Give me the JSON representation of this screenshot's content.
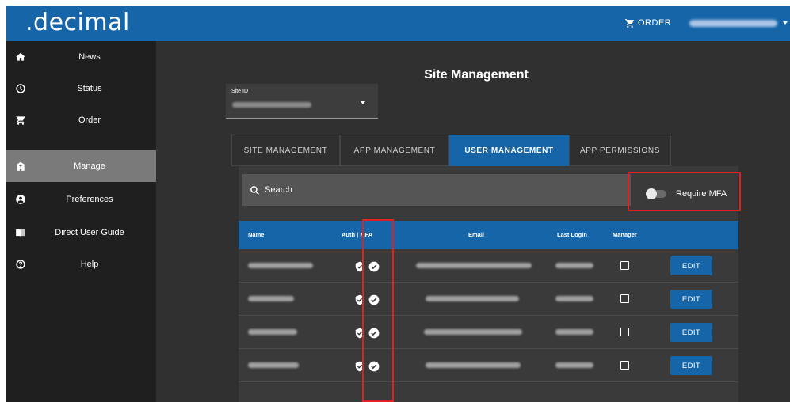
{
  "app": {
    "logo": ".decimal"
  },
  "topbar": {
    "order_label": "ORDER"
  },
  "sidebar": {
    "items": [
      {
        "label": "News",
        "icon": "home-icon"
      },
      {
        "label": "Status",
        "icon": "clock-icon"
      },
      {
        "label": "Order",
        "icon": "cart-icon"
      },
      {
        "label": "Manage",
        "icon": "hospital-icon",
        "active": true
      },
      {
        "label": "Preferences",
        "icon": "account-circle-icon"
      },
      {
        "label": "Direct User Guide",
        "icon": "book-icon"
      },
      {
        "label": "Help",
        "icon": "help-circle-icon"
      }
    ]
  },
  "main": {
    "title": "Site Management",
    "site_select": {
      "label": "Site ID"
    },
    "tabs": [
      {
        "label": "SITE MANAGEMENT"
      },
      {
        "label": "APP MANAGEMENT"
      },
      {
        "label": "USER MANAGEMENT",
        "active": true
      },
      {
        "label": "APP PERMISSIONS"
      }
    ],
    "search": {
      "placeholder": "Search"
    },
    "require_mfa": {
      "label": "Require MFA",
      "enabled": false
    },
    "table": {
      "columns": [
        "Name",
        "Auth | MFA",
        "Email",
        "Last Login",
        "Manager"
      ],
      "rows": [
        {
          "edit_label": "EDIT",
          "manager": false
        },
        {
          "edit_label": "EDIT",
          "manager": false
        },
        {
          "edit_label": "EDIT",
          "manager": false
        },
        {
          "edit_label": "EDIT",
          "manager": false
        }
      ]
    }
  },
  "colors": {
    "primary": "#1565a8",
    "sidebar_bg": "#1f1f1f",
    "main_bg": "#303030",
    "active_nav": "#7a7a7a",
    "highlight": "#e32020"
  }
}
